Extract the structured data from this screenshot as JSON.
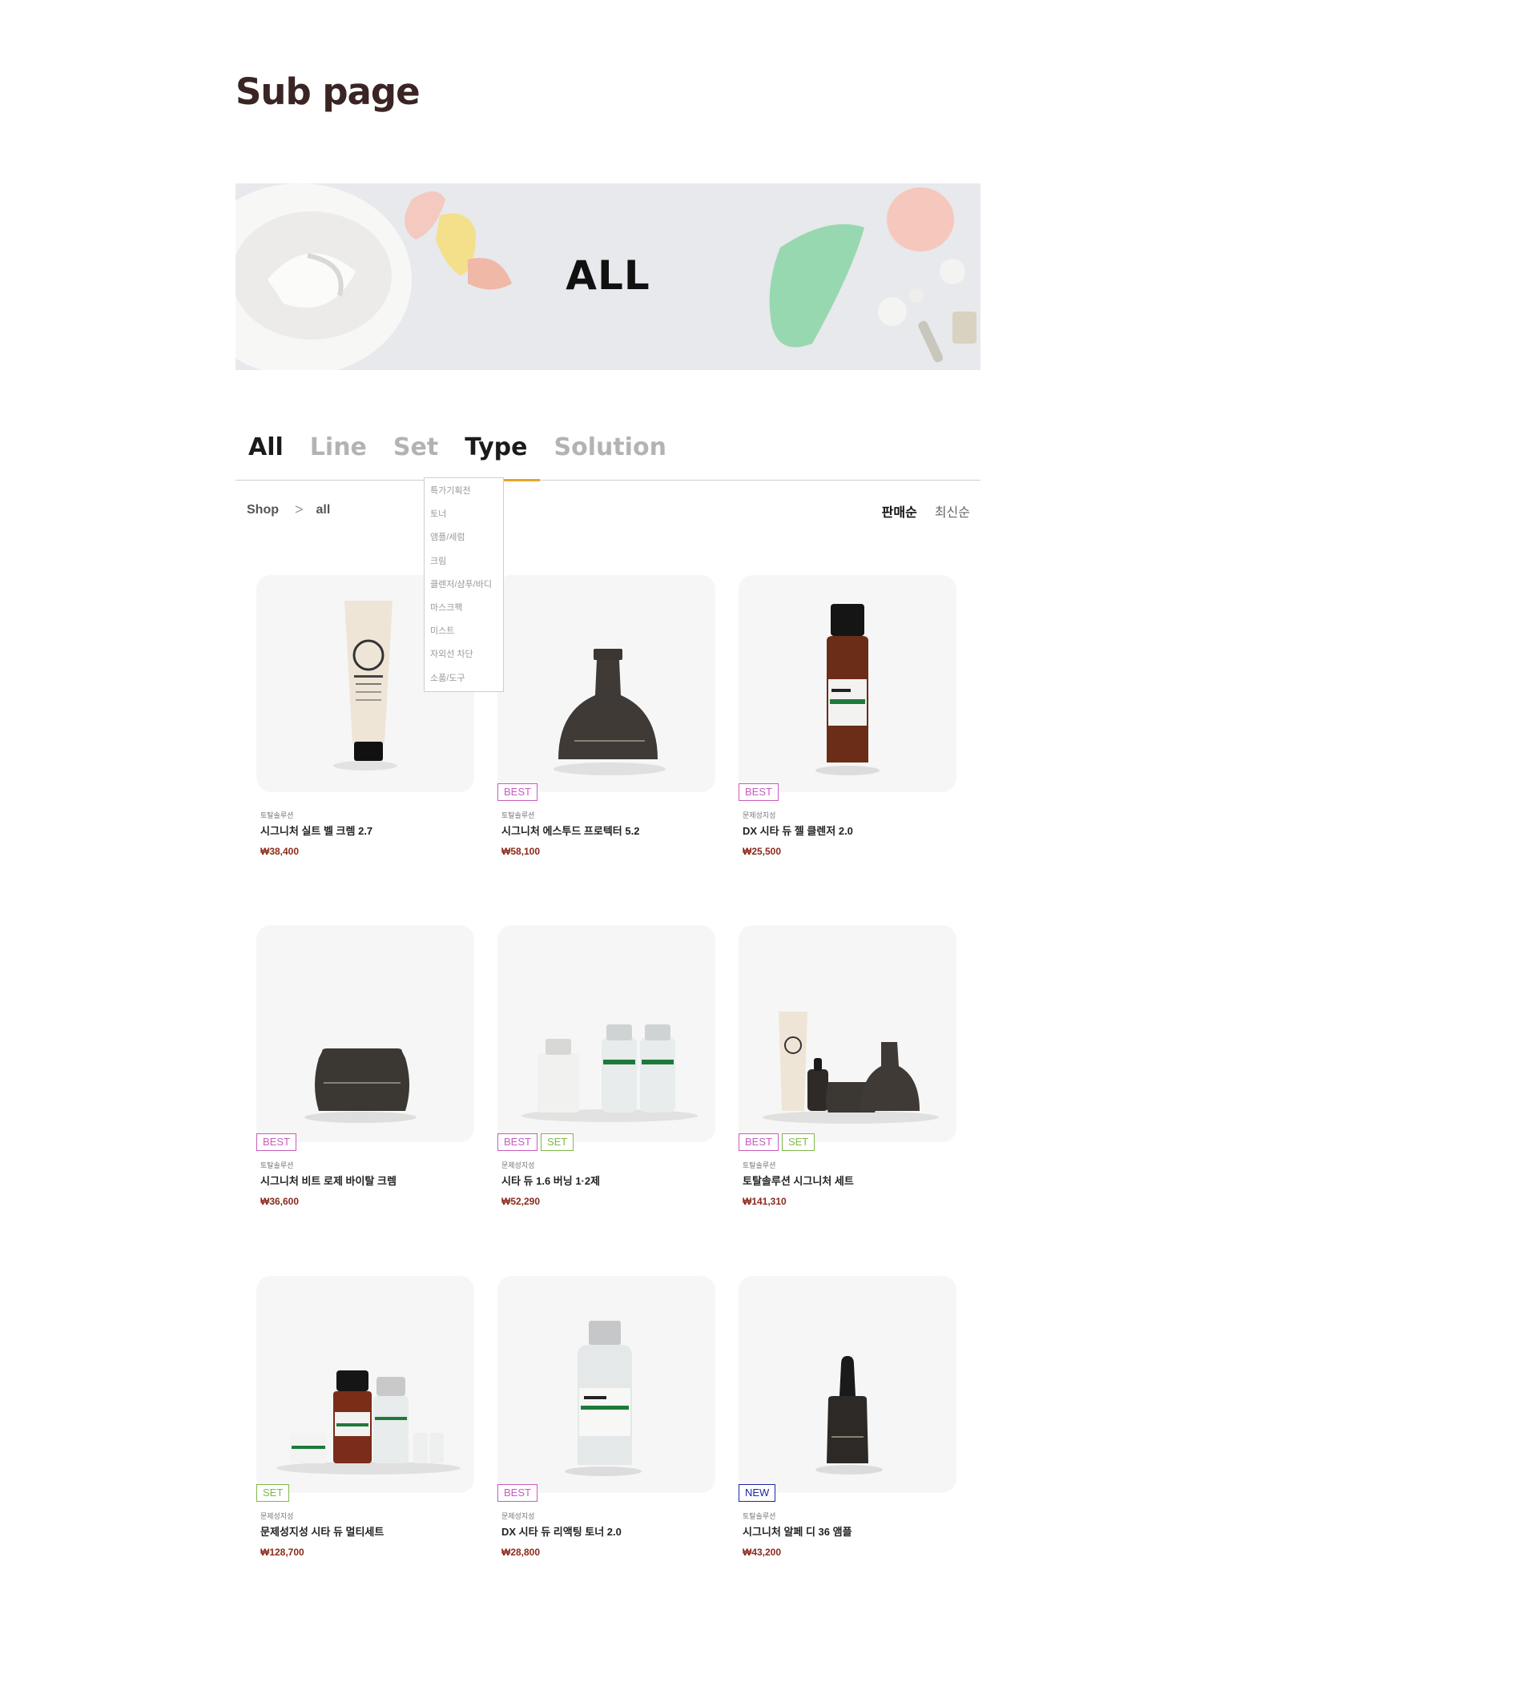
{
  "page_title": "Sub page",
  "banner": {
    "title": "ALL"
  },
  "tabs": [
    {
      "label": "All",
      "state": "active"
    },
    {
      "label": "Line",
      "state": "inactive"
    },
    {
      "label": "Set",
      "state": "inactive"
    },
    {
      "label": "Type",
      "state": "open"
    },
    {
      "label": "Solution",
      "state": "inactive"
    }
  ],
  "breadcrumb": {
    "root": "Shop",
    "separator": ">",
    "current": "all"
  },
  "sort": {
    "selected": "판매순",
    "other": "최신순"
  },
  "type_dropdown": [
    "특가기획전",
    "토너",
    "앰플/세럼",
    "크림",
    "클렌저/샴푸/바디",
    "마스크팩",
    "미스트",
    "자외선 차단",
    "소품/도구"
  ],
  "colors": {
    "best": "#c75cbf",
    "set": "#7fb84a",
    "new": "#1a27a8",
    "price": "#8a2a1a",
    "tab_underline": "#e6a52a"
  },
  "products": [
    {
      "category": "토탈솔루션",
      "name": "시그니처 실트 벨 크렘 2.7",
      "price": "₩38,400",
      "badges": [],
      "image": "white-tube"
    },
    {
      "category": "토탈솔루션",
      "name": "시그니처 에스투드 프로텍터 5.2",
      "price": "₩58,100",
      "badges": [
        "BEST"
      ],
      "image": "dark-pump-bottle"
    },
    {
      "category": "문제성지성",
      "name": "DX 시타 듀 젤 클렌저 2.0",
      "price": "₩25,500",
      "badges": [
        "BEST"
      ],
      "image": "amber-bottle"
    },
    {
      "category": "토탈솔루션",
      "name": "시그니처 비트 로제 바이탈 크렘",
      "price": "₩36,600",
      "badges": [
        "BEST"
      ],
      "image": "dark-jar"
    },
    {
      "category": "문제성지성",
      "name": "시타 듀 1.6 버닝 1·2제",
      "price": "₩52,290",
      "badges": [
        "BEST",
        "SET"
      ],
      "image": "vial-set"
    },
    {
      "category": "토탈솔루션",
      "name": "토탈솔루션 시그니처 세트",
      "price": "₩141,310",
      "badges": [
        "BEST",
        "SET"
      ],
      "image": "signature-set"
    },
    {
      "category": "문제성지성",
      "name": "문제성지성 시타 듀 멀티세트",
      "price": "₩128,700",
      "badges": [
        "SET"
      ],
      "image": "multi-set"
    },
    {
      "category": "문제성지성",
      "name": "DX 시타 듀 리액팅 토너 2.0",
      "price": "₩28,800",
      "badges": [
        "BEST"
      ],
      "image": "clear-bottle"
    },
    {
      "category": "토탈솔루션",
      "name": "시그니처 알페 디 36 앰플",
      "price": "₩43,200",
      "badges": [
        "NEW"
      ],
      "image": "dropper-bottle"
    }
  ]
}
